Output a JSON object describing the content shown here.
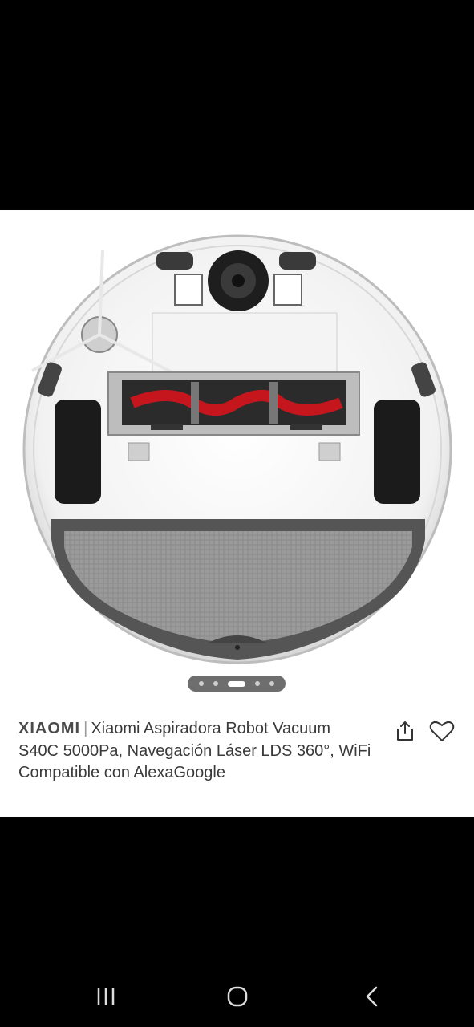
{
  "product": {
    "brand": "XIAOMI",
    "separator": "|",
    "title": "Xiaomi Aspiradora Robot Vacuum S40C 5000Pa, Navegación Láser LDS 360°, WiFi Compatible con AlexaGoogle"
  },
  "gallery": {
    "image_count": 5,
    "active_index": 3
  },
  "icons": {
    "share": "share-icon",
    "favorite": "heart-icon",
    "nav_recents": "recents-icon",
    "nav_home": "home-icon",
    "nav_back": "back-icon"
  },
  "colors": {
    "background": "#ffffff",
    "text": "#3a3a3a",
    "brush_red": "#c4161c"
  }
}
